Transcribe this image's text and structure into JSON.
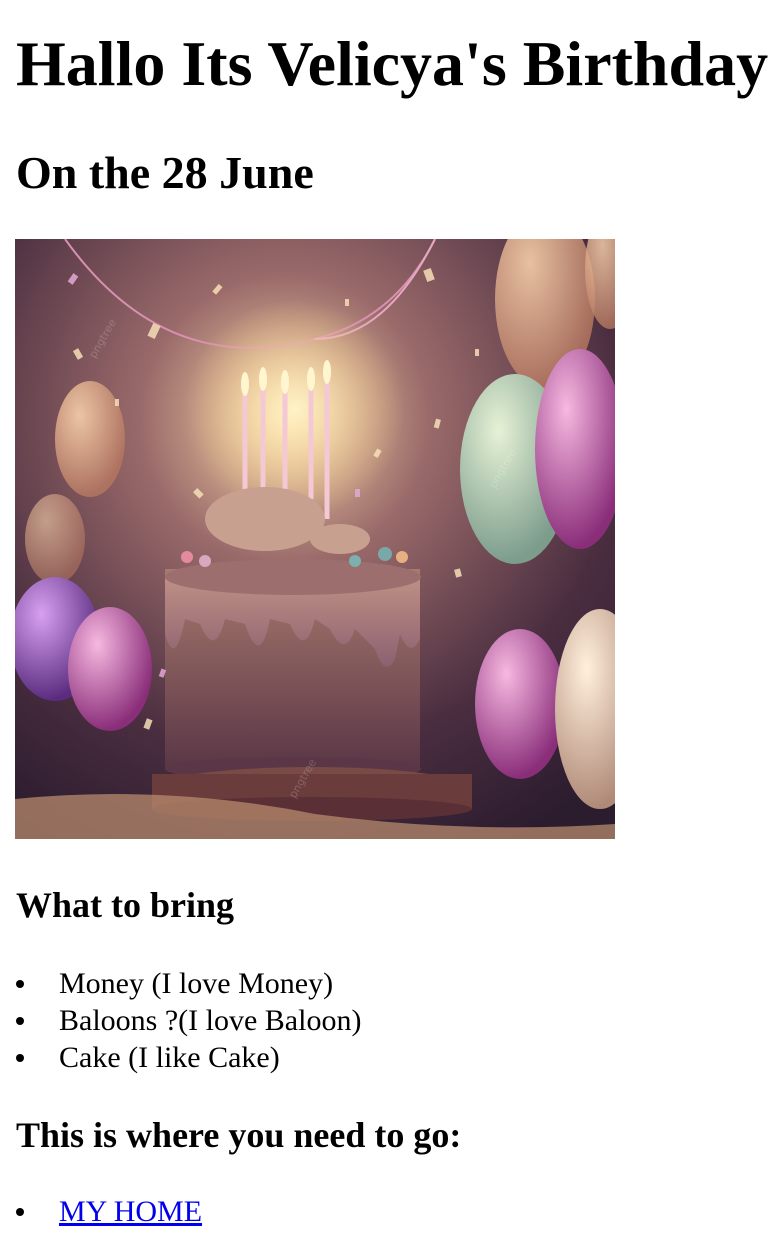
{
  "heading": "Hallo Its Velicya's Birthday",
  "date_heading": "On the 28 June",
  "image": {
    "description_icon": "birthday-cake-image",
    "watermark": "pngtree"
  },
  "bring_section": {
    "title": "What to bring",
    "items": [
      "Money (I love Money)",
      "Baloons ?(I love Baloon)",
      "Cake (I like Cake)"
    ]
  },
  "where_section": {
    "title": "This is where you need to go:",
    "link_label": "MY HOME"
  },
  "colors": {
    "link": "#0000ee",
    "text": "#000000",
    "background": "#ffffff"
  }
}
